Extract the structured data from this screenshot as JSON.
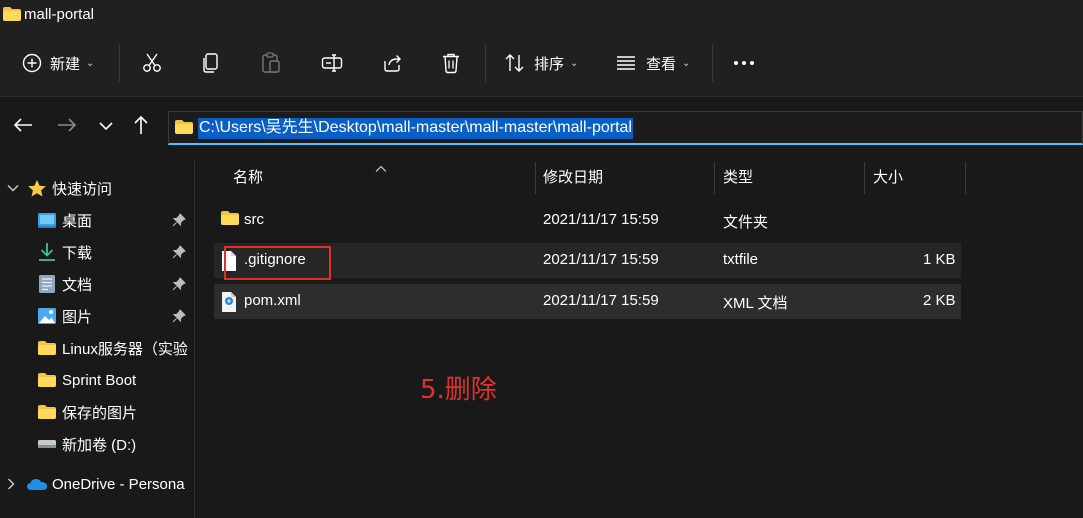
{
  "window": {
    "title": "mall-portal"
  },
  "toolbar": {
    "new_label": "新建",
    "sort_label": "排序",
    "view_label": "查看",
    "icons": [
      "plus-circle-icon",
      "cut-icon",
      "copy-icon",
      "paste-icon",
      "rename-icon",
      "share-icon",
      "delete-icon",
      "sort-icon",
      "view-icon",
      "more-icon"
    ]
  },
  "address": {
    "path": "C:\\Users\\吴先生\\Desktop\\mall-master\\mall-master\\mall-portal"
  },
  "sidebar": {
    "quick_access": "快速访问",
    "items": [
      {
        "label": "桌面",
        "icon": "desktop-icon",
        "pinned": true
      },
      {
        "label": "下载",
        "icon": "download-icon",
        "pinned": true
      },
      {
        "label": "文档",
        "icon": "document-icon",
        "pinned": true
      },
      {
        "label": "图片",
        "icon": "pictures-icon",
        "pinned": true
      },
      {
        "label": "Linux服务器（实验",
        "icon": "folder-icon",
        "pinned": false
      },
      {
        "label": "Sprint Boot",
        "icon": "folder-icon",
        "pinned": false
      },
      {
        "label": "保存的图片",
        "icon": "folder-icon",
        "pinned": false
      },
      {
        "label": "新加卷 (D:)",
        "icon": "drive-icon",
        "pinned": false
      }
    ],
    "onedrive": "OneDrive - Persona"
  },
  "columns": {
    "name": "名称",
    "modified": "修改日期",
    "type": "类型",
    "size": "大小"
  },
  "files": [
    {
      "name": "src",
      "modified": "2021/11/17 15:59",
      "type": "文件夹",
      "size": ""
    },
    {
      "name": ".gitignore",
      "modified": "2021/11/17 15:59",
      "type": "txtfile",
      "size": "1 KB"
    },
    {
      "name": "pom.xml",
      "modified": "2021/11/17 15:59",
      "type": "XML 文档",
      "size": "2 KB"
    }
  ],
  "annotation": "5.删除",
  "colors": {
    "accent": "#4cc2ff",
    "selection": "#0a5fc4",
    "annotation_red": "#e0312f",
    "folder": "#f5c342"
  }
}
